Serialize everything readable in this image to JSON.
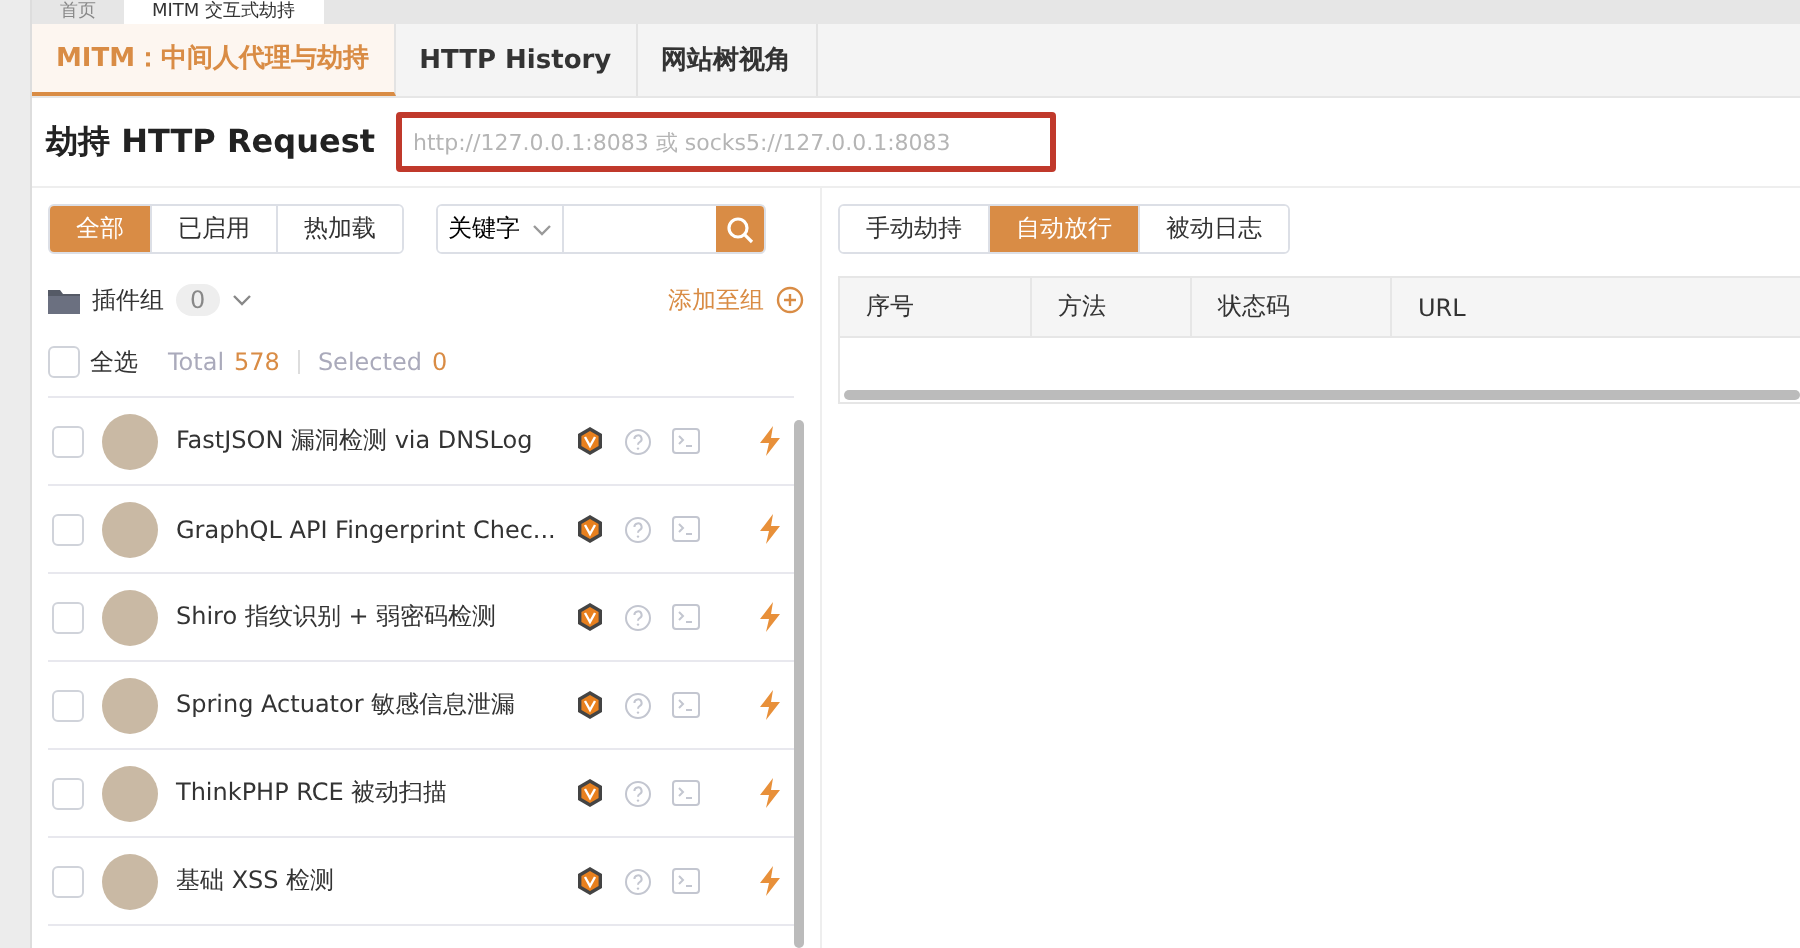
{
  "top_tabs": [
    {
      "label": "首页",
      "selected": false
    },
    {
      "label": "MITM 交互式劫持",
      "selected": true
    }
  ],
  "tabs": [
    {
      "label": "MITM：中间人代理与劫持",
      "selected": true
    },
    {
      "label": "HTTP History",
      "selected": false
    },
    {
      "label": "网站树视角",
      "selected": false
    }
  ],
  "header": {
    "title": "劫持 HTTP Request",
    "proxy_field": {
      "placeholder": "http://127.0.0.1:8083 或 socks5://127.0.0.1:8083"
    }
  },
  "filter_buttons": [
    {
      "label": "全部",
      "selected": true
    },
    {
      "label": "已启用",
      "selected": false
    },
    {
      "label": "热加载",
      "selected": false
    }
  ],
  "search": {
    "type_label": "关键字"
  },
  "group": {
    "label": "插件组",
    "count": "0",
    "add_label": "添加至组"
  },
  "select_all": {
    "label": "全选",
    "checked": false,
    "total_label": "Total",
    "total": "578",
    "selected_label": "Selected",
    "selected": "0"
  },
  "plugins": [
    {
      "name": "FastJSON 漏洞检测 via DNSLog",
      "checked": false
    },
    {
      "name": "GraphQL API Fingerprint Chec...",
      "checked": false
    },
    {
      "name": "Shiro 指纹识别 + 弱密码检测",
      "checked": false
    },
    {
      "name": "Spring Actuator 敏感信息泄漏",
      "checked": false
    },
    {
      "name": "ThinkPHP RCE 被动扫描",
      "checked": false
    },
    {
      "name": "基础 XSS 检测",
      "checked": false
    }
  ],
  "mode_buttons": [
    {
      "label": "手动劫持",
      "selected": false
    },
    {
      "label": "自动放行",
      "selected": true
    },
    {
      "label": "被动日志",
      "selected": false
    }
  ],
  "table": {
    "columns": [
      "序号",
      "方法",
      "状态码",
      "URL"
    ]
  }
}
